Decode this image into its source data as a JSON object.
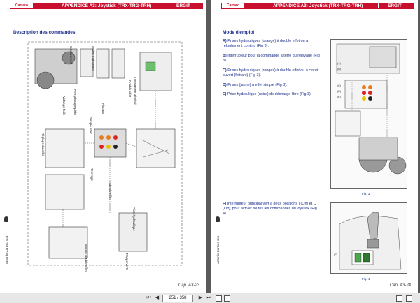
{
  "header": {
    "logo": "Carraro",
    "title": "APPENDICE A3: Joystick (TRX-TRG-TRH)",
    "code": "ERGIT"
  },
  "left_page": {
    "section_title": "Description des commandes",
    "page_ref": "Cap. A3-23",
    "side_text": "Antonio Carraro spa",
    "labels": {
      "interrupteur_general": "Interrupteur général",
      "double_effet": "Double effet",
      "action_maintenue": "Action maintenue",
      "flottant": "Flottant",
      "retour": "Retour",
      "soulevement": "Soulèvement",
      "double_effet_2": "Double effet",
      "simple_effet": "Simple effet",
      "remplissage_plein": "Remplissage plein",
      "vidange_huile": "Vidange huile",
      "retour_relevage": "Relevage",
      "relevage": "Relevage",
      "reglage_debit": "Réglage du débit",
      "simple_effet_2": "Simple effet",
      "moteur_double_effet": "Moteur double effet",
      "prise_hydraulique": "Prise hydraulique",
      "moteur_simple_effet": "Moteur simple effet",
      "trappe_verte": "Trappe verte"
    }
  },
  "right_page": {
    "section_title": "Mode d'emploi",
    "page_ref": "Cap. A3-24",
    "side_text": "Antonio Carraro spa",
    "items": [
      {
        "letter": "A)",
        "text": "Prises hydrauliques (orange) à double effet ou à refoulement continu (Fig 3)."
      },
      {
        "letter": "B)",
        "text": "Interrupteur pour la commande à terre du relevage (Fig 3)."
      },
      {
        "letter": "C)",
        "text": "Prises hydrauliques (rouges) à double effet ou à circuit ouvert (flottant) (Fig 3)."
      },
      {
        "letter": "D)",
        "text": "Prises (jaune) à effet simple (Fig 3)."
      },
      {
        "letter": "E)",
        "text": "Prise hydraulique (noire) de décharge libre (Fig 3)."
      }
    ],
    "item_f": {
      "letter": "F)",
      "text": "Interrupteur principal vert à deux positions I (On) et O (Off), pour activer toutes les commandes du joystick (Fig 4)."
    },
    "fig3_caption": "Fig. 3",
    "fig4_caption": "Fig. 4",
    "fig3_labels": [
      "(A)",
      "(B)",
      "(C)",
      "(D)",
      "(E)"
    ],
    "fig4_label": "(F)"
  },
  "toolbar": {
    "page_indicator": "251 / 358"
  },
  "colors": {
    "header_red": "#c8102e",
    "text_blue": "#1a2e8c",
    "viewer_bg": "#5a5a5a"
  }
}
